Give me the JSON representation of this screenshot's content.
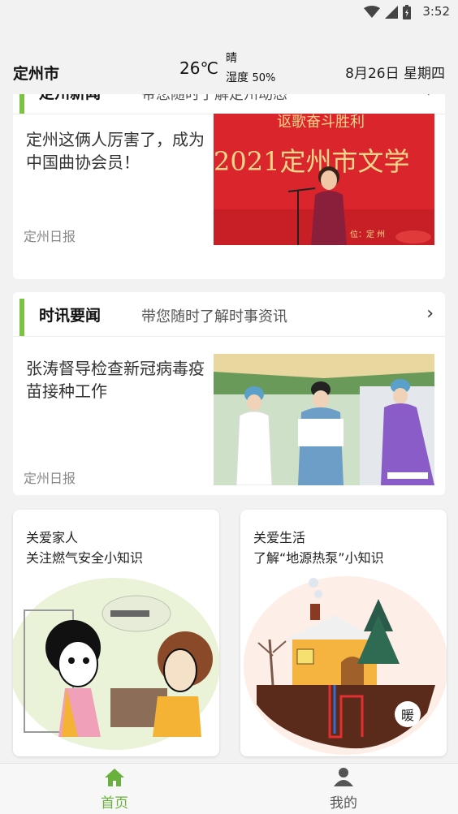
{
  "status_bar": {
    "time": "3:52"
  },
  "header": {
    "city": "定州市",
    "temperature": "26℃",
    "weather": "晴",
    "humidity_label": "湿度",
    "humidity_value": "50%",
    "date": "8月26日 星期四"
  },
  "sections": [
    {
      "title": "定州新闻",
      "subtitle": "带您随时了解定州动态",
      "arrow": "›",
      "news": {
        "title": "定州这俩人厉害了，成为中国曲协会员！",
        "source": "定州日报"
      },
      "image_text": {
        "top": "讴歌奋斗胜利",
        "banner": "2021定州市文学",
        "caption": "位：定 州"
      }
    },
    {
      "title": "时讯要闻",
      "subtitle": "带您随时了解时事资讯",
      "arrow": "›",
      "news": {
        "title": "张涛督导检查新冠病毒疫苗接种工作",
        "source": "定州日报"
      }
    }
  ],
  "tiles": [
    {
      "line1": "关爱家人",
      "line2": "关注燃气安全小知识"
    },
    {
      "line1": "关爱生活",
      "line2": "了解“地源热泵”小知识",
      "badge": "暖"
    }
  ],
  "tabbar": {
    "home_label": "首页",
    "mine_label": "我的",
    "active_color": "#6ab03c",
    "inactive_color": "#555555"
  }
}
